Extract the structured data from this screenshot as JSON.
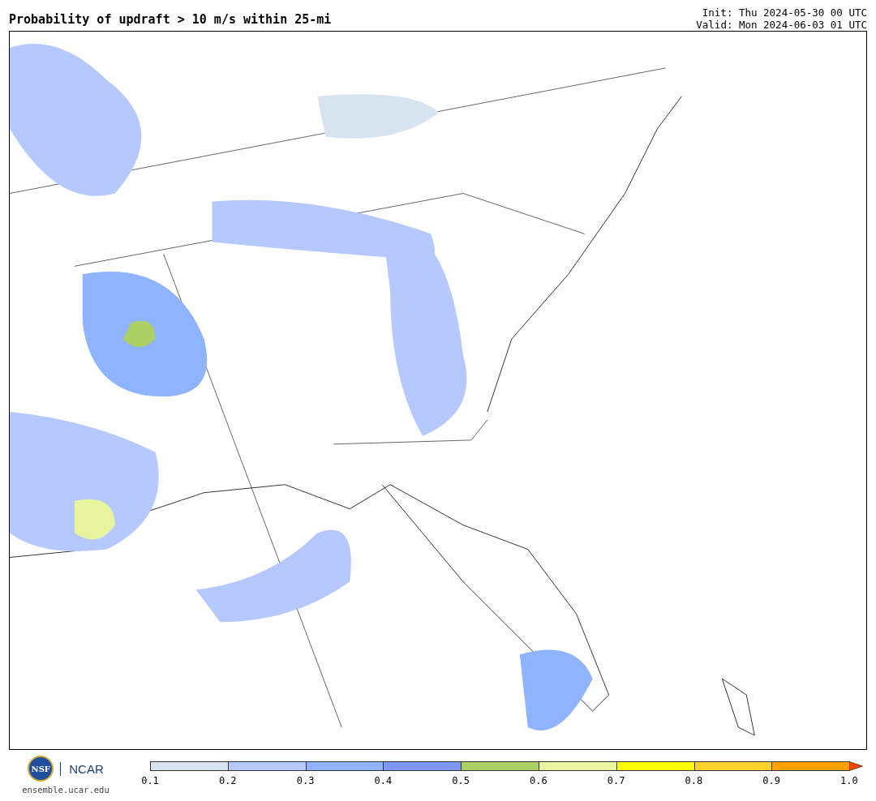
{
  "header": {
    "title": "Probability of updraft > 10 m/s within 25-mi",
    "init": "Init: Thu 2024-05-30 00 UTC",
    "valid": "Valid: Mon 2024-06-03 01 UTC"
  },
  "footer": {
    "logos": [
      {
        "kind": "seal",
        "text": "NSF"
      },
      {
        "kind": "wordmark",
        "text": "NCAR"
      }
    ],
    "site": "ensemble.ucar.edu"
  },
  "colorbar": {
    "segments": [
      {
        "color": "#d7e3ee"
      },
      {
        "color": "#b5c9ff"
      },
      {
        "color": "#8fb3ff"
      },
      {
        "color": "#7f97ff"
      },
      {
        "color": "#abcf63"
      },
      {
        "color": "#e8f59e"
      },
      {
        "color": "#ffff00"
      },
      {
        "color": "#ffd32b"
      },
      {
        "color": "#ffa100"
      }
    ],
    "extend_arrow": {
      "color": "#ff4500"
    },
    "ticks": [
      "0.1",
      "0.2",
      "0.3",
      "0.4",
      "0.5",
      "0.6",
      "0.7",
      "0.8",
      "0.9",
      "1.0"
    ]
  }
}
